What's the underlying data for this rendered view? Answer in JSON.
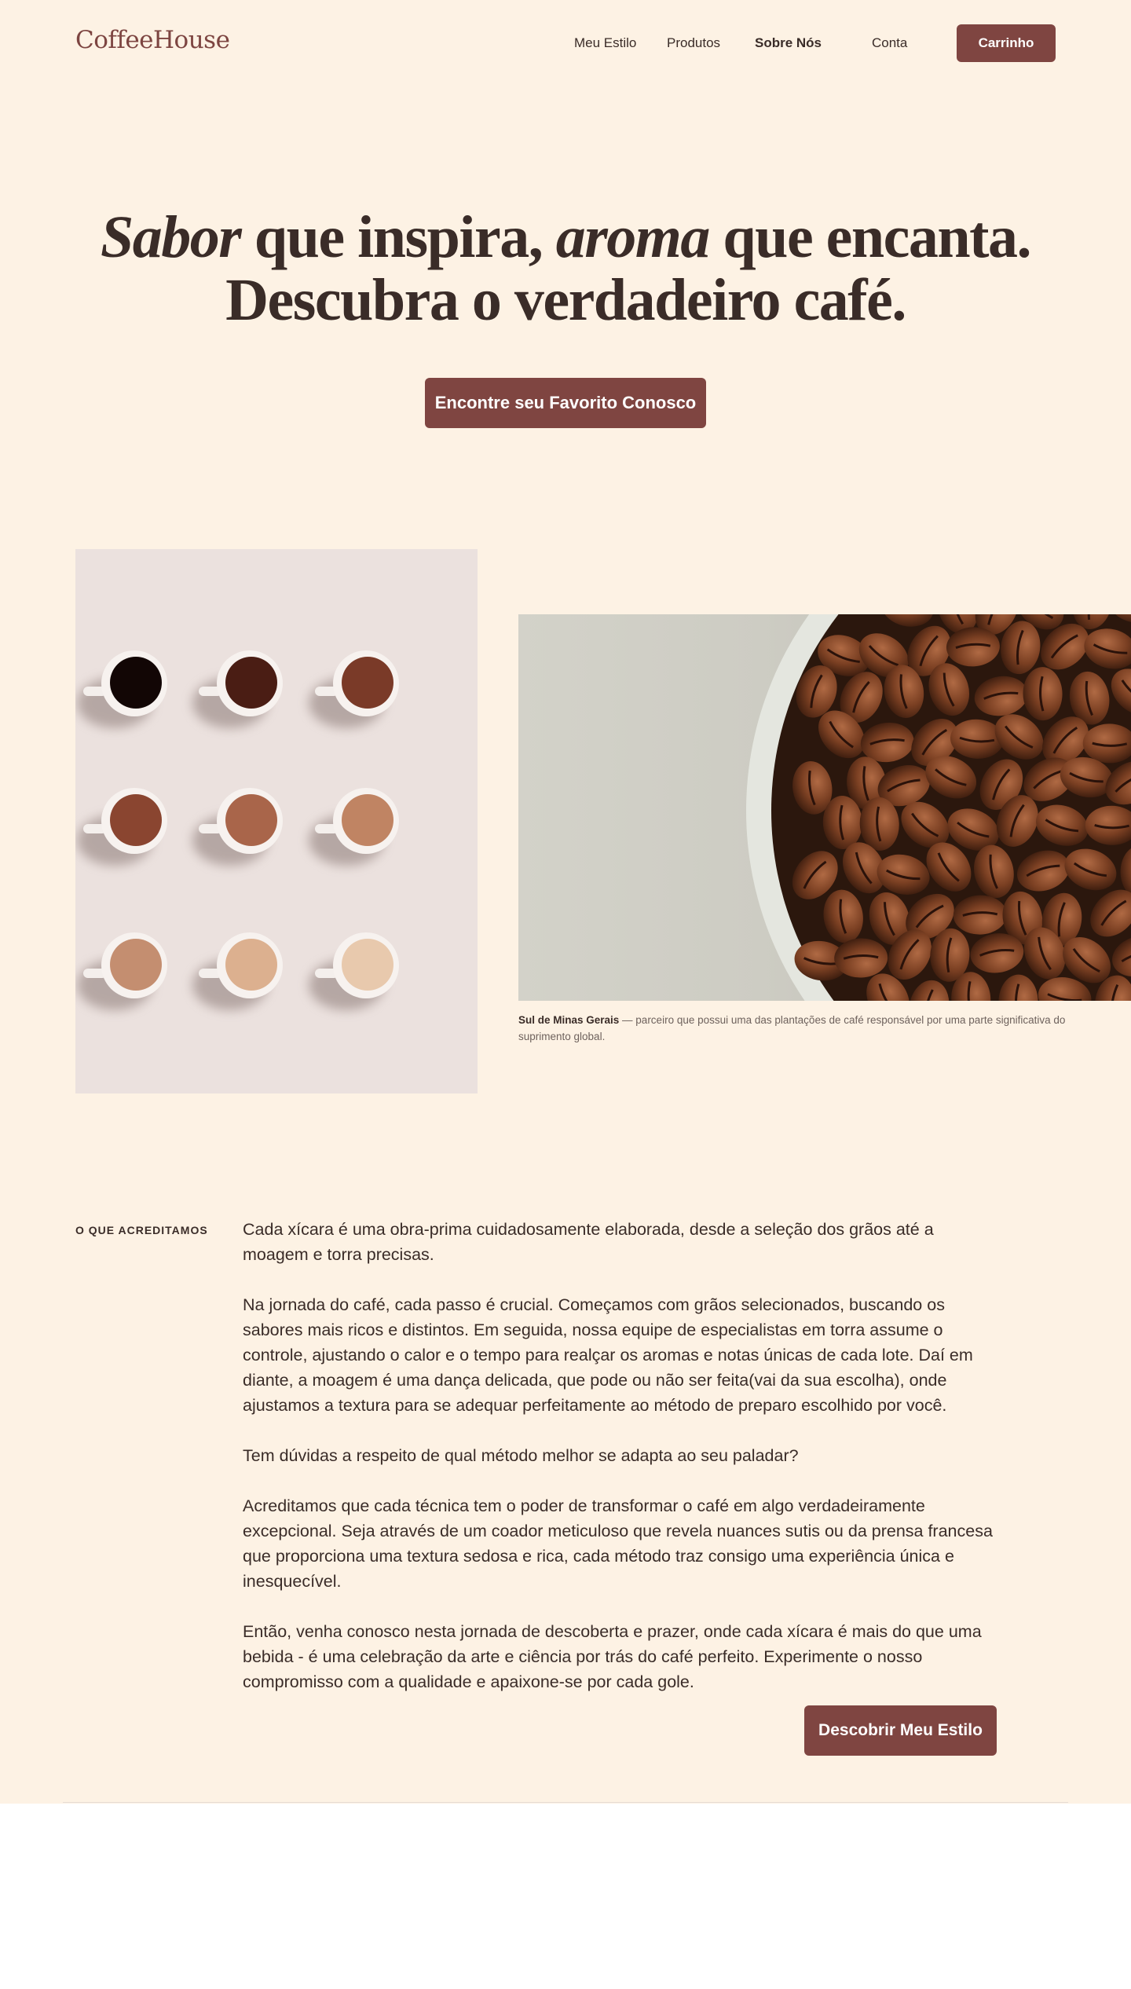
{
  "header": {
    "logo": "CoffeeHouse",
    "nav": [
      {
        "label": "Meu Estilo"
      },
      {
        "label": "Produtos"
      },
      {
        "label": "Sobre Nós"
      },
      {
        "label": "Conta"
      }
    ],
    "cart_label": "Carrinho"
  },
  "hero": {
    "line1_italic_a": "Sabor",
    "line1_a": " que inspira, ",
    "line1_italic_b": "aroma",
    "line1_b": " que encanta.",
    "line2_a": "Descubra o ",
    "line2_bold": "verdadeiro",
    "line2_b": " café.",
    "cta_label": "Encontre seu Favorito Conosco"
  },
  "gallery": {
    "caption_bold": "Sul de Minas Gerais",
    "caption_text": " — parceiro que possui uma das plantações de café responsável por uma parte significativa do suprimento global."
  },
  "beliefs": {
    "label": "O QUE ACREDITAMOS",
    "paragraphs": [
      "Cada xícara é uma obra-prima cuidadosamente elaborada, desde a seleção dos grãos até a moagem e torra precisas.",
      "Na jornada do café, cada passo é crucial. Começamos com grãos selecionados, buscando os sabores mais ricos e distintos. Em seguida, nossa equipe de especialistas em torra assume o controle, ajustando o calor e o tempo para realçar os aromas e notas únicas de cada lote. Daí em diante, a moagem é uma dança delicada, que pode ou não ser feita(vai da sua escolha), onde ajustamos a textura para se adequar perfeitamente ao método de preparo escolhido por você.",
      "Tem dúvidas a respeito de qual método melhor se adapta ao seu paladar?",
      "Acreditamos que cada técnica tem o poder de transformar o café em algo verdadeiramente excepcional. Seja através de um coador meticuloso que revela nuances sutis ou da prensa francesa que proporciona uma textura sedosa e rica, cada método traz consigo uma experiência única e inesquecível.",
      "Então, venha conosco nesta jornada de descoberta e prazer, onde cada xícara é mais do que uma bebida - é uma celebração da arte e ciência por trás do café perfeito. Experimente o nosso compromisso com a qualidade e apaixone-se por cada gole."
    ],
    "cta_label": "Descobrir Meu Estilo"
  },
  "colors": {
    "background": "#fdf2e4",
    "accent": "#7f4541",
    "text": "#3a2c28"
  }
}
